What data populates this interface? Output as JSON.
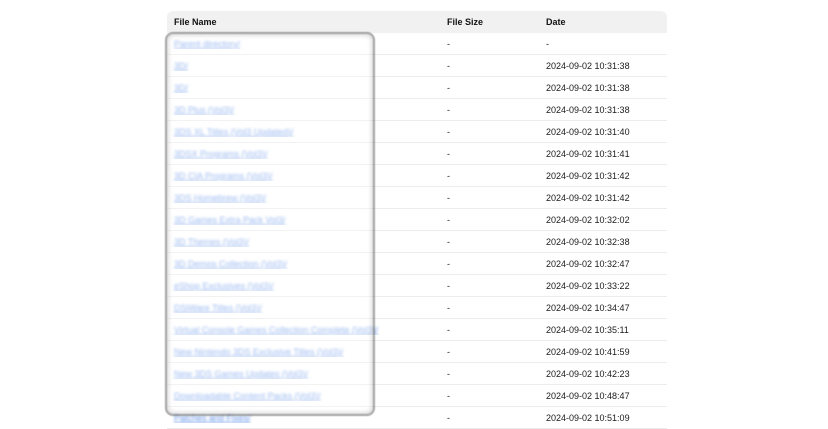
{
  "table": {
    "headers": {
      "name": "File Name",
      "size": "File Size",
      "date": "Date"
    },
    "rows": [
      {
        "name": "Parent directory/",
        "size": "-",
        "date": "-"
      },
      {
        "name": "3D/",
        "size": "-",
        "date": "2024-09-02 10:31:38"
      },
      {
        "name": "3D/",
        "size": "-",
        "date": "2024-09-02 10:31:38"
      },
      {
        "name": "3D Plus (Vol3)/",
        "size": "-",
        "date": "2024-09-02 10:31:38"
      },
      {
        "name": "3DS XL Titles (Vol3 Updated)/",
        "size": "-",
        "date": "2024-09-02 10:31:40"
      },
      {
        "name": "3DSX Programs (Vol3)/",
        "size": "-",
        "date": "2024-09-02 10:31:41"
      },
      {
        "name": "3D CIA Programs (Vol3)/",
        "size": "-",
        "date": "2024-09-02 10:31:42"
      },
      {
        "name": "3DS Homebrew (Vol3)/",
        "size": "-",
        "date": "2024-09-02 10:31:42"
      },
      {
        "name": "3D Games Extra Pack Vol3/",
        "size": "-",
        "date": "2024-09-02 10:32:02"
      },
      {
        "name": "3D Themes (Vol3)/",
        "size": "-",
        "date": "2024-09-02 10:32:38"
      },
      {
        "name": "3D Demos Collection (Vol3)/",
        "size": "-",
        "date": "2024-09-02 10:32:47"
      },
      {
        "name": "eShop Exclusives (Vol3)/",
        "size": "-",
        "date": "2024-09-02 10:33:22"
      },
      {
        "name": "DSiWare Titles (Vol3)/",
        "size": "-",
        "date": "2024-09-02 10:34:47"
      },
      {
        "name": "Virtual Console Games Collection Complete (Vol3)/",
        "size": "-",
        "date": "2024-09-02 10:35:11"
      },
      {
        "name": "New Nintendo 3DS Exclusive Titles (Vol3)/",
        "size": "-",
        "date": "2024-09-02 10:41:59"
      },
      {
        "name": "New 3DS Games Updates (Vol3)/",
        "size": "-",
        "date": "2024-09-02 10:42:23"
      },
      {
        "name": "Downloadable Content Packs (Vol3)/",
        "size": "-",
        "date": "2024-09-02 10:48:47"
      },
      {
        "name": "Patches and Fixes/",
        "size": "-",
        "date": "2024-09-02 10:51:09"
      }
    ]
  }
}
